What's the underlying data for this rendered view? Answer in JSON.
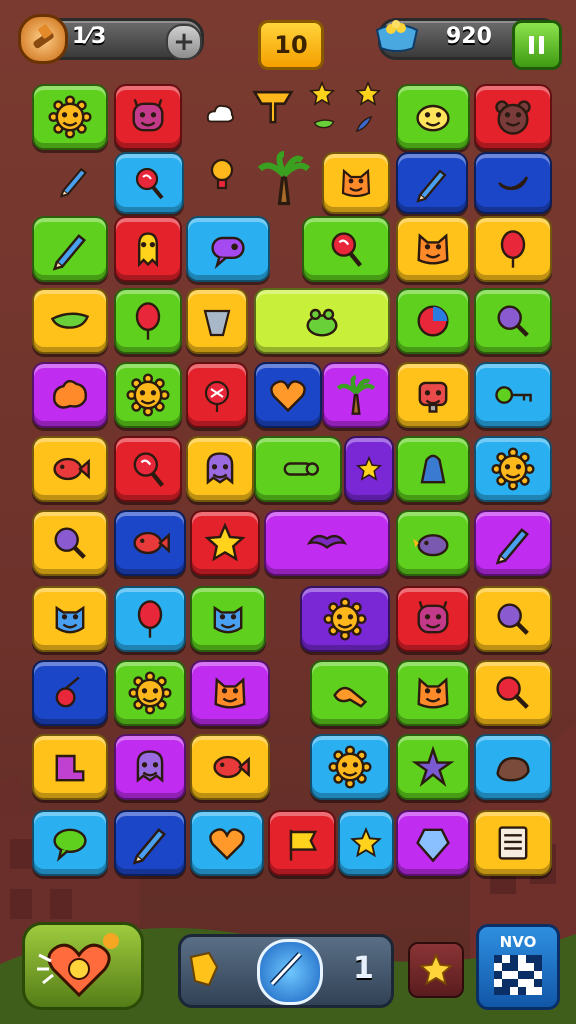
{
  "hud": {
    "lives": "1⁄3",
    "plus_label": "+",
    "level": "10",
    "score": "920"
  },
  "colors": {
    "green": "#5fd01e",
    "red": "#e3222b",
    "blue": "#2ab0f0",
    "yellow": "#ffc21a",
    "purple": "#c02cf0",
    "navy": "#1c46c8",
    "violet": "#7a28d6",
    "lime": "#c8f03a"
  },
  "board": {
    "tiles": [
      {
        "color": "green",
        "icon": "sun-face-icon"
      },
      {
        "color": "red",
        "icon": "monster-face-icon"
      },
      {
        "color": "green",
        "icon": "lemon-face-icon"
      },
      {
        "color": "red",
        "icon": "bear-face-icon"
      },
      {
        "color": "blue",
        "icon": "lollipop-icon"
      },
      {
        "color": "yellow",
        "icon": "cat-face-icon"
      },
      {
        "color": "navy",
        "icon": "pencil-icon"
      },
      {
        "color": "navy",
        "icon": "banana-icon"
      },
      {
        "color": "green",
        "icon": "pencil-icon"
      },
      {
        "color": "red",
        "icon": "alien-icon"
      },
      {
        "color": "blue",
        "icon": "speech-fish-icon"
      },
      {
        "color": "green",
        "icon": "lollipop-icon"
      },
      {
        "color": "yellow",
        "icon": "cat-face-icon"
      },
      {
        "color": "yellow",
        "icon": "balloon-icon"
      },
      {
        "color": "yellow",
        "icon": "leaf-icon"
      },
      {
        "color": "green",
        "icon": "balloon-icon"
      },
      {
        "color": "yellow",
        "icon": "bucket-icon"
      },
      {
        "color": "lime",
        "icon": "frog-icon"
      },
      {
        "color": "green",
        "icon": "orb-icon"
      },
      {
        "color": "green",
        "icon": "magnifier-icon"
      },
      {
        "color": "purple",
        "icon": "blob-icon"
      },
      {
        "color": "green",
        "icon": "sun-face-icon"
      },
      {
        "color": "red",
        "icon": "candy-icon"
      },
      {
        "color": "navy",
        "icon": "heart-icon"
      },
      {
        "color": "purple",
        "icon": "palm-tree-icon"
      },
      {
        "color": "yellow",
        "icon": "robot-face-icon"
      },
      {
        "color": "blue",
        "icon": "key-icon"
      },
      {
        "color": "yellow",
        "icon": "fish-icon"
      },
      {
        "color": "red",
        "icon": "lollipop-icon"
      },
      {
        "color": "yellow",
        "icon": "ghost-icon"
      },
      {
        "color": "green",
        "icon": "bone-icon"
      },
      {
        "color": "violet",
        "icon": "star-icon"
      },
      {
        "color": "green",
        "icon": "bell-icon"
      },
      {
        "color": "blue",
        "icon": "sun-face-icon"
      },
      {
        "color": "yellow",
        "icon": "magnifier-icon"
      },
      {
        "color": "navy",
        "icon": "fish-icon"
      },
      {
        "color": "red",
        "icon": "star-icon"
      },
      {
        "color": "purple",
        "icon": "bat-icon"
      },
      {
        "color": "green",
        "icon": "bird-icon"
      },
      {
        "color": "purple",
        "icon": "pencil-icon"
      },
      {
        "color": "yellow",
        "icon": "owl-face-icon"
      },
      {
        "color": "blue",
        "icon": "balloon-icon"
      },
      {
        "color": "green",
        "icon": "owl-face-icon"
      },
      {
        "color": "violet",
        "icon": "sun-face-icon"
      },
      {
        "color": "red",
        "icon": "monster-face-icon"
      },
      {
        "color": "yellow",
        "icon": "magnifier-icon"
      },
      {
        "color": "navy",
        "icon": "cherry-icon"
      },
      {
        "color": "green",
        "icon": "sun-face-icon"
      },
      {
        "color": "purple",
        "icon": "cat-face-icon"
      },
      {
        "color": "green",
        "icon": "horn-icon"
      },
      {
        "color": "green",
        "icon": "cat-face-icon"
      },
      {
        "color": "yellow",
        "icon": "maraca-icon"
      },
      {
        "color": "yellow",
        "icon": "sock-icon"
      },
      {
        "color": "purple",
        "icon": "ghost-icon"
      },
      {
        "color": "yellow",
        "icon": "fish-icon"
      },
      {
        "color": "blue",
        "icon": "sun-face-icon"
      },
      {
        "color": "green",
        "icon": "starfish-icon"
      },
      {
        "color": "blue",
        "icon": "rock-icon"
      },
      {
        "color": "blue",
        "icon": "speech-bubble-icon"
      },
      {
        "color": "navy",
        "icon": "pencil-icon"
      },
      {
        "color": "blue",
        "icon": "heart-icon"
      },
      {
        "color": "red",
        "icon": "flag-icon"
      },
      {
        "color": "blue",
        "icon": "star-icon"
      },
      {
        "color": "purple",
        "icon": "gem-icon"
      },
      {
        "color": "yellow",
        "icon": "note-icon"
      }
    ]
  },
  "loose_items": [
    {
      "icon": "cloud-icon"
    },
    {
      "icon": "ribbon-icon"
    },
    {
      "icon": "star-icon"
    },
    {
      "icon": "star-icon"
    },
    {
      "icon": "leaf-icon"
    },
    {
      "icon": "feather-icon"
    },
    {
      "icon": "pencil-icon"
    },
    {
      "icon": "bulb-icon"
    },
    {
      "icon": "palm-tree-icon"
    }
  ],
  "bottom_bar": {
    "booster_icon": "heart-hammer-icon",
    "moves_value": "1",
    "progress_icon": "sword-icon",
    "star_button_icon": "star-icon",
    "qr_button_label": "NVO"
  }
}
